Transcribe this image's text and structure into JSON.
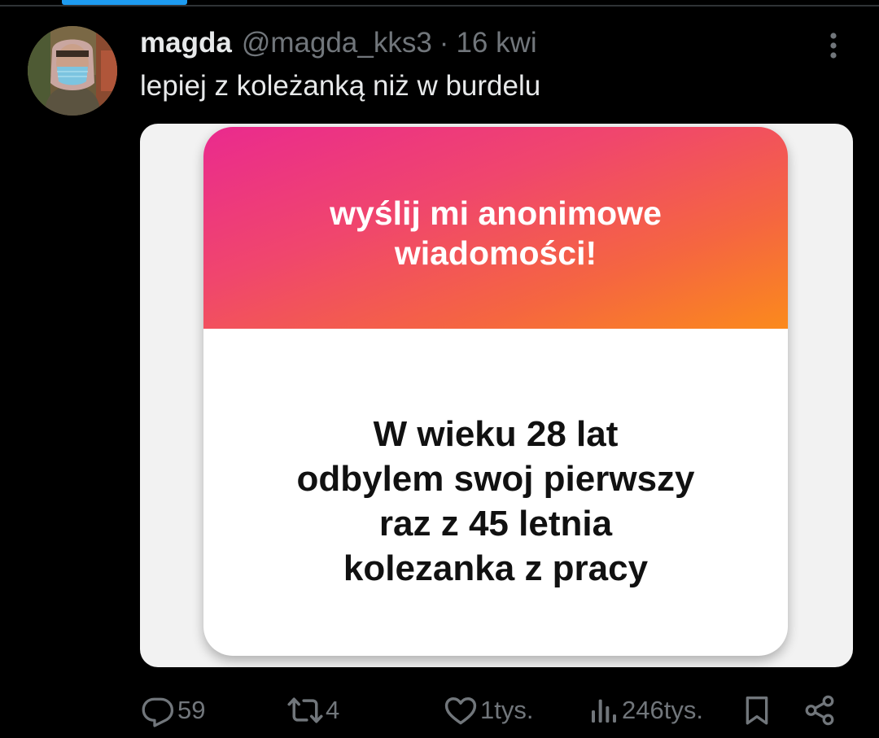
{
  "tweet": {
    "author_name": "magda",
    "author_handle": "@magda_kks3",
    "separator": "·",
    "date": "16 kwi",
    "text": "lepiej z koleżanką niż w burdelu"
  },
  "media": {
    "header_lines": [
      "wyślij mi anonimowe",
      "wiadomości!"
    ],
    "message_lines": [
      "W wieku 28 lat",
      "odbylem swoj pierwszy",
      "raz z 45 letnia",
      "kolezanka z pracy"
    ]
  },
  "actions": {
    "replies": "59",
    "reposts": "4",
    "likes": "1tys.",
    "views": "246tys."
  },
  "icons": {
    "more": "more-vertical-icon",
    "reply": "reply-icon",
    "repost": "repost-icon",
    "like": "heart-icon",
    "views": "views-chart-icon",
    "bookmark": "bookmark-icon",
    "share": "share-icon"
  },
  "colors": {
    "background": "#000000",
    "text_primary": "#e7e9ea",
    "text_secondary": "#71767b",
    "accent": "#1d9bf0",
    "gradient_start": "#ea2a8e",
    "gradient_end": "#fb8a1c"
  }
}
